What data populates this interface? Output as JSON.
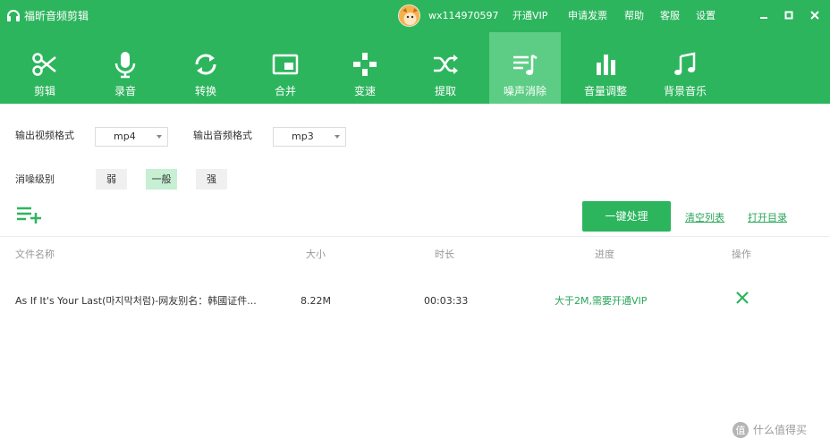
{
  "app": {
    "title": "福昕音频剪辑"
  },
  "user": {
    "name": "wx114970597"
  },
  "top_links": [
    "开通VIP",
    "申请发票",
    "帮助",
    "客服",
    "设置"
  ],
  "window_controls": [
    "minimize-icon",
    "maximize-icon",
    "close-icon"
  ],
  "toolbar": {
    "active_index": 6,
    "items": [
      {
        "label": "剪辑",
        "icon": "scissors-icon"
      },
      {
        "label": "录音",
        "icon": "microphone-icon"
      },
      {
        "label": "转换",
        "icon": "convert-icon"
      },
      {
        "label": "合并",
        "icon": "merge-icon"
      },
      {
        "label": "变速",
        "icon": "speed-icon"
      },
      {
        "label": "提取",
        "icon": "extract-icon"
      },
      {
        "label": "噪声消除",
        "icon": "noise-reduction-icon"
      },
      {
        "label": "音量调整",
        "icon": "volume-icon"
      },
      {
        "label": "背景音乐",
        "icon": "music-note-icon"
      }
    ]
  },
  "settings": {
    "video_format_label": "输出视频格式",
    "video_format_value": "mp4",
    "audio_format_label": "输出音频格式",
    "audio_format_value": "mp3",
    "level_label": "消噪级别",
    "levels": [
      "弱",
      "一般",
      "强"
    ],
    "selected_level": "一般"
  },
  "actions": {
    "process_label": "一键处理",
    "clear_label": "清空列表",
    "open_dir_label": "打开目录"
  },
  "table": {
    "headers": [
      "文件名称",
      "大小",
      "时长",
      "进度",
      "操作"
    ],
    "rows": [
      {
        "name": "As If It's Your Last(마지막처럼)-网友别名：韩國证件...",
        "size": "8.22M",
        "duration": "00:03:33",
        "progress": "大于2M,需要开通VIP"
      }
    ]
  },
  "watermark": {
    "text": "什么值得买"
  },
  "colors": {
    "brand": "#2db55d",
    "active_tool": "#5dcd85",
    "link": "#2aa65a",
    "selected_level": "#c6efd4"
  }
}
